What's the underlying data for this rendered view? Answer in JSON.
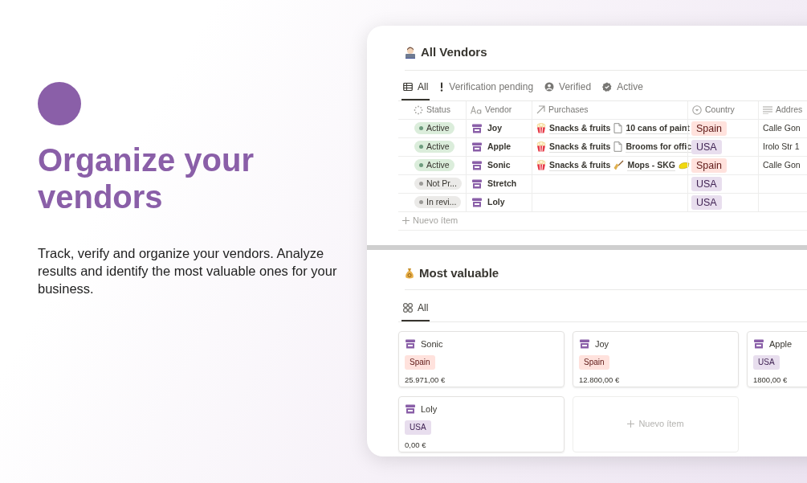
{
  "hero": {
    "heading": "Organize your vendors",
    "text": "Track, verify and organize your vendors. Analyze results and identify the most valuable ones for your business."
  },
  "vendors": {
    "title": "All Vendors",
    "tabs": [
      {
        "label": "All",
        "selected": true
      },
      {
        "label": "Verification pending",
        "selected": false
      },
      {
        "label": "Verified",
        "selected": false
      },
      {
        "label": "Active",
        "selected": false
      }
    ],
    "columns": [
      {
        "label": "Status"
      },
      {
        "label": "Vendor"
      },
      {
        "label": "Purchases"
      },
      {
        "label": "Country"
      },
      {
        "label": "Addres"
      }
    ],
    "rows": [
      {
        "status": {
          "label": "Active",
          "color": "#dbeddb"
        },
        "vendor": "Joy",
        "purchases": [
          {
            "kind": "popcorn",
            "label": "Snacks & fruits"
          },
          {
            "kind": "document",
            "label": "10 cans of paint"
          }
        ],
        "country": {
          "label": "Spain",
          "color": "#ffe2dd"
        },
        "address": "Calle Gon"
      },
      {
        "status": {
          "label": "Active",
          "color": "#dbeddb"
        },
        "vendor": "Apple",
        "purchases": [
          {
            "kind": "popcorn",
            "label": "Snacks & fruits"
          },
          {
            "kind": "document",
            "label": "Brooms for offic"
          }
        ],
        "country": {
          "label": "USA",
          "color": "#e8deee"
        },
        "address": "Irolo Str 1"
      },
      {
        "status": {
          "label": "Active",
          "color": "#dbeddb"
        },
        "vendor": "Sonic",
        "purchases": [
          {
            "kind": "popcorn",
            "label": "Snacks & fruits"
          },
          {
            "kind": "broom",
            "label": "Mops - SKG"
          },
          {
            "kind": "sponge"
          }
        ],
        "country": {
          "label": "Spain",
          "color": "#ffe2dd"
        },
        "address": "Calle Gon"
      },
      {
        "status": {
          "label": "Not Pr...",
          "color": "#ebeae8"
        },
        "vendor": "Stretch",
        "purchases": [],
        "country": {
          "label": "USA",
          "color": "#e8deee"
        }
      },
      {
        "status": {
          "label": "In revi...",
          "color": "#ebeae8"
        },
        "vendor": "Loly",
        "purchases": [],
        "country": {
          "label": "USA",
          "color": "#e8deee"
        }
      }
    ],
    "new_item": "Nuevo ítem"
  },
  "valuable": {
    "title": "Most valuable",
    "tabs": [
      {
        "label": "All",
        "selected": true
      }
    ],
    "cards": [
      {
        "name": "Sonic",
        "country": {
          "label": "Spain",
          "color": "#ffe2dd"
        },
        "amount": "25.971,00 €"
      },
      {
        "name": "Joy",
        "country": {
          "label": "Spain",
          "color": "#ffe2dd"
        },
        "amount": "12.800,00 €"
      },
      {
        "name": "Apple",
        "country": {
          "label": "USA",
          "color": "#e8deee"
        },
        "amount": "1800,00 €"
      },
      {
        "name": "Loly",
        "country": {
          "label": "USA",
          "color": "#e8deee"
        },
        "amount": "0,00 €"
      }
    ],
    "new_item": "Nuevo ítem"
  }
}
